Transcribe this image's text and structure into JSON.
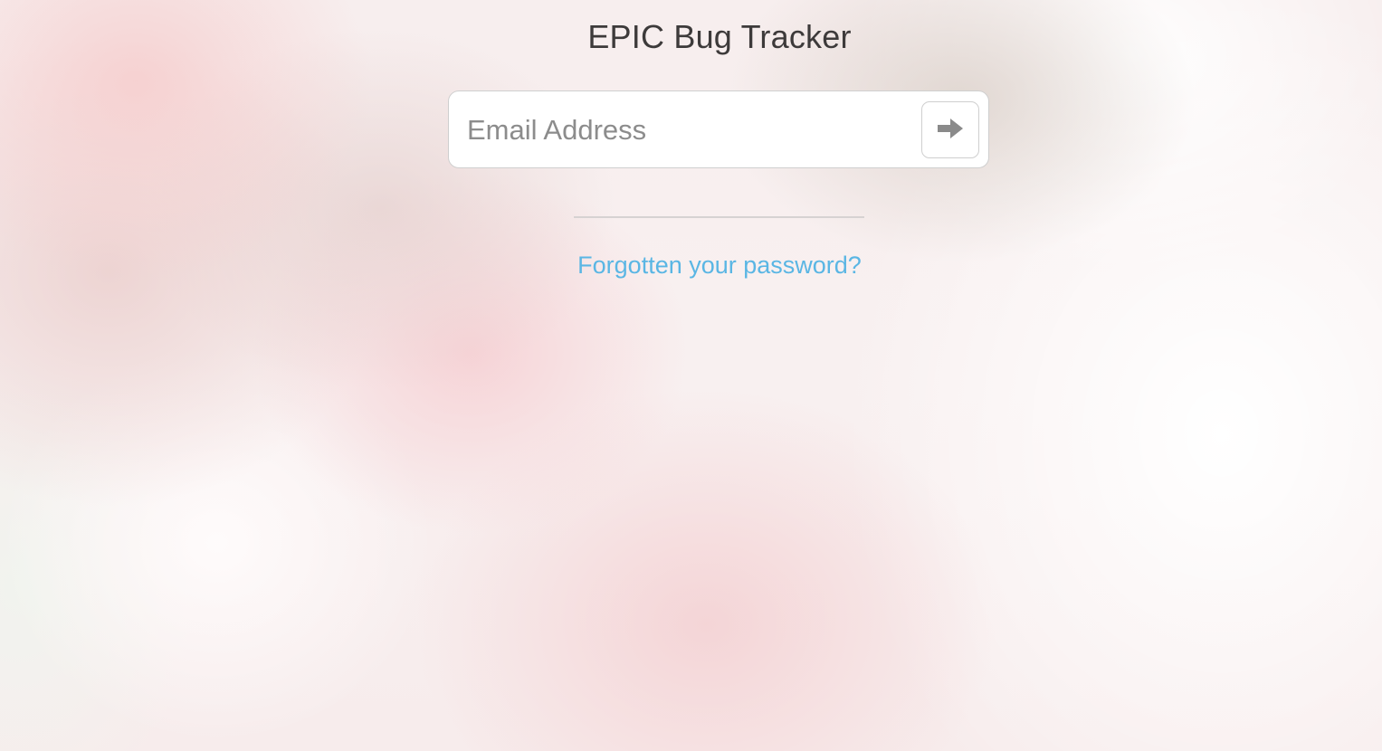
{
  "page": {
    "title": "EPIC Bug Tracker"
  },
  "login": {
    "email_placeholder": "Email Address",
    "email_value": "",
    "submit_icon": "arrow-right-icon"
  },
  "links": {
    "forgot_password": "Forgotten your password?"
  },
  "colors": {
    "link": "#5ab6e4",
    "title_text": "#3d3a3a",
    "placeholder": "#8c8c8c",
    "icon": "#8a8a8a",
    "border": "#cfcfcf"
  }
}
